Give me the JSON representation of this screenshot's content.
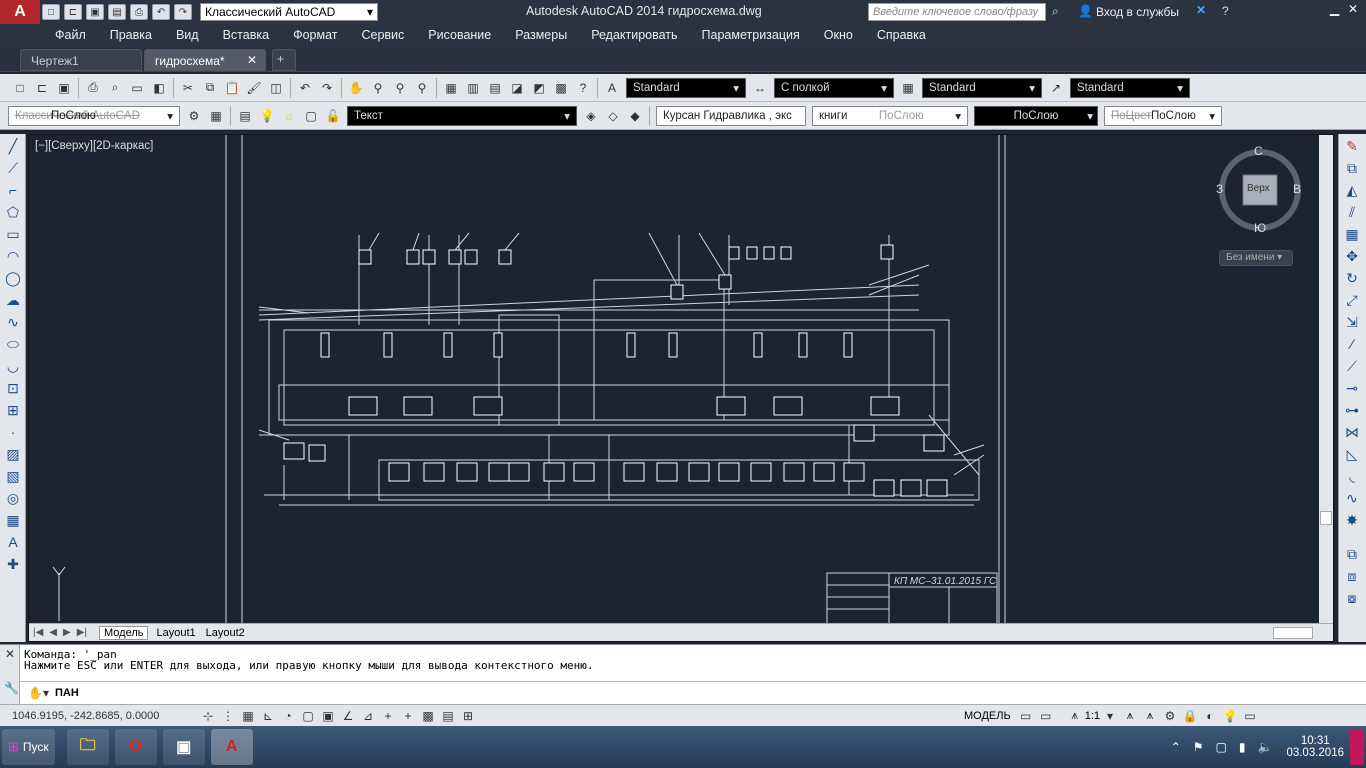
{
  "app": {
    "title": "Autodesk AutoCAD 2014   гидросхема.dwg",
    "app_button_label": "A",
    "workspace": "Классический AutoCAD",
    "search_placeholder": "Введите ключевое слово/фразу",
    "signin_label": "Вход в службы"
  },
  "menu": [
    "Файл",
    "Правка",
    "Вид",
    "Вставка",
    "Формат",
    "Сервис",
    "Рисование",
    "Размеры",
    "Редактировать",
    "Параметризация",
    "Окно",
    "Справка"
  ],
  "tabs": [
    {
      "label": "Чертеж1"
    },
    {
      "label": "гидросхема*"
    }
  ],
  "toolbar1": {
    "text_style": "Standard",
    "dim_style": "С полкой",
    "table_style": "Standard",
    "mleader_style": "Standard"
  },
  "toolbar2": {
    "color_combo": "ПоСлою",
    "color_combo_ghost": "Классический AutoCAD",
    "layer_combo": "Текст",
    "linetype_combo": "Курсан Гидравлика , экс",
    "lineweight_label": "книги",
    "lineweight_ghost": "ПоСлою",
    "plotstyle_combo": "ПоСлою",
    "layer_prop_combo": "ПоСлою",
    "layer_prop_ghost": "ПоЦвет"
  },
  "viewport": {
    "label": "[−][Сверху][2D-каркас]",
    "viewcube": {
      "north": "С",
      "south": "Ю",
      "west": "З",
      "east": "В",
      "face": "Верх"
    },
    "ucs_name": "Без имени",
    "title_block_code": "КП МС–31.01.2015 ГС"
  },
  "layout_tabs": [
    "Модель",
    "Layout1",
    "Layout2"
  ],
  "command": {
    "history": [
      "Команда:  '_pan",
      "Нажмите ESC или ENTER для выхода, или правую кнопку мыши для вывода контекстного меню."
    ],
    "current": "ПАН"
  },
  "status": {
    "coords": "1046.9195, -242.8685, 0.0000",
    "model_label": "МОДЕЛЬ",
    "scale": "1:1"
  },
  "taskbar": {
    "start_label": "Пуск",
    "time": "10:31",
    "date": "03.03.2016"
  },
  "colors": {
    "autocad_red": "#b3262a",
    "canvas_bg": "#1d2431"
  }
}
